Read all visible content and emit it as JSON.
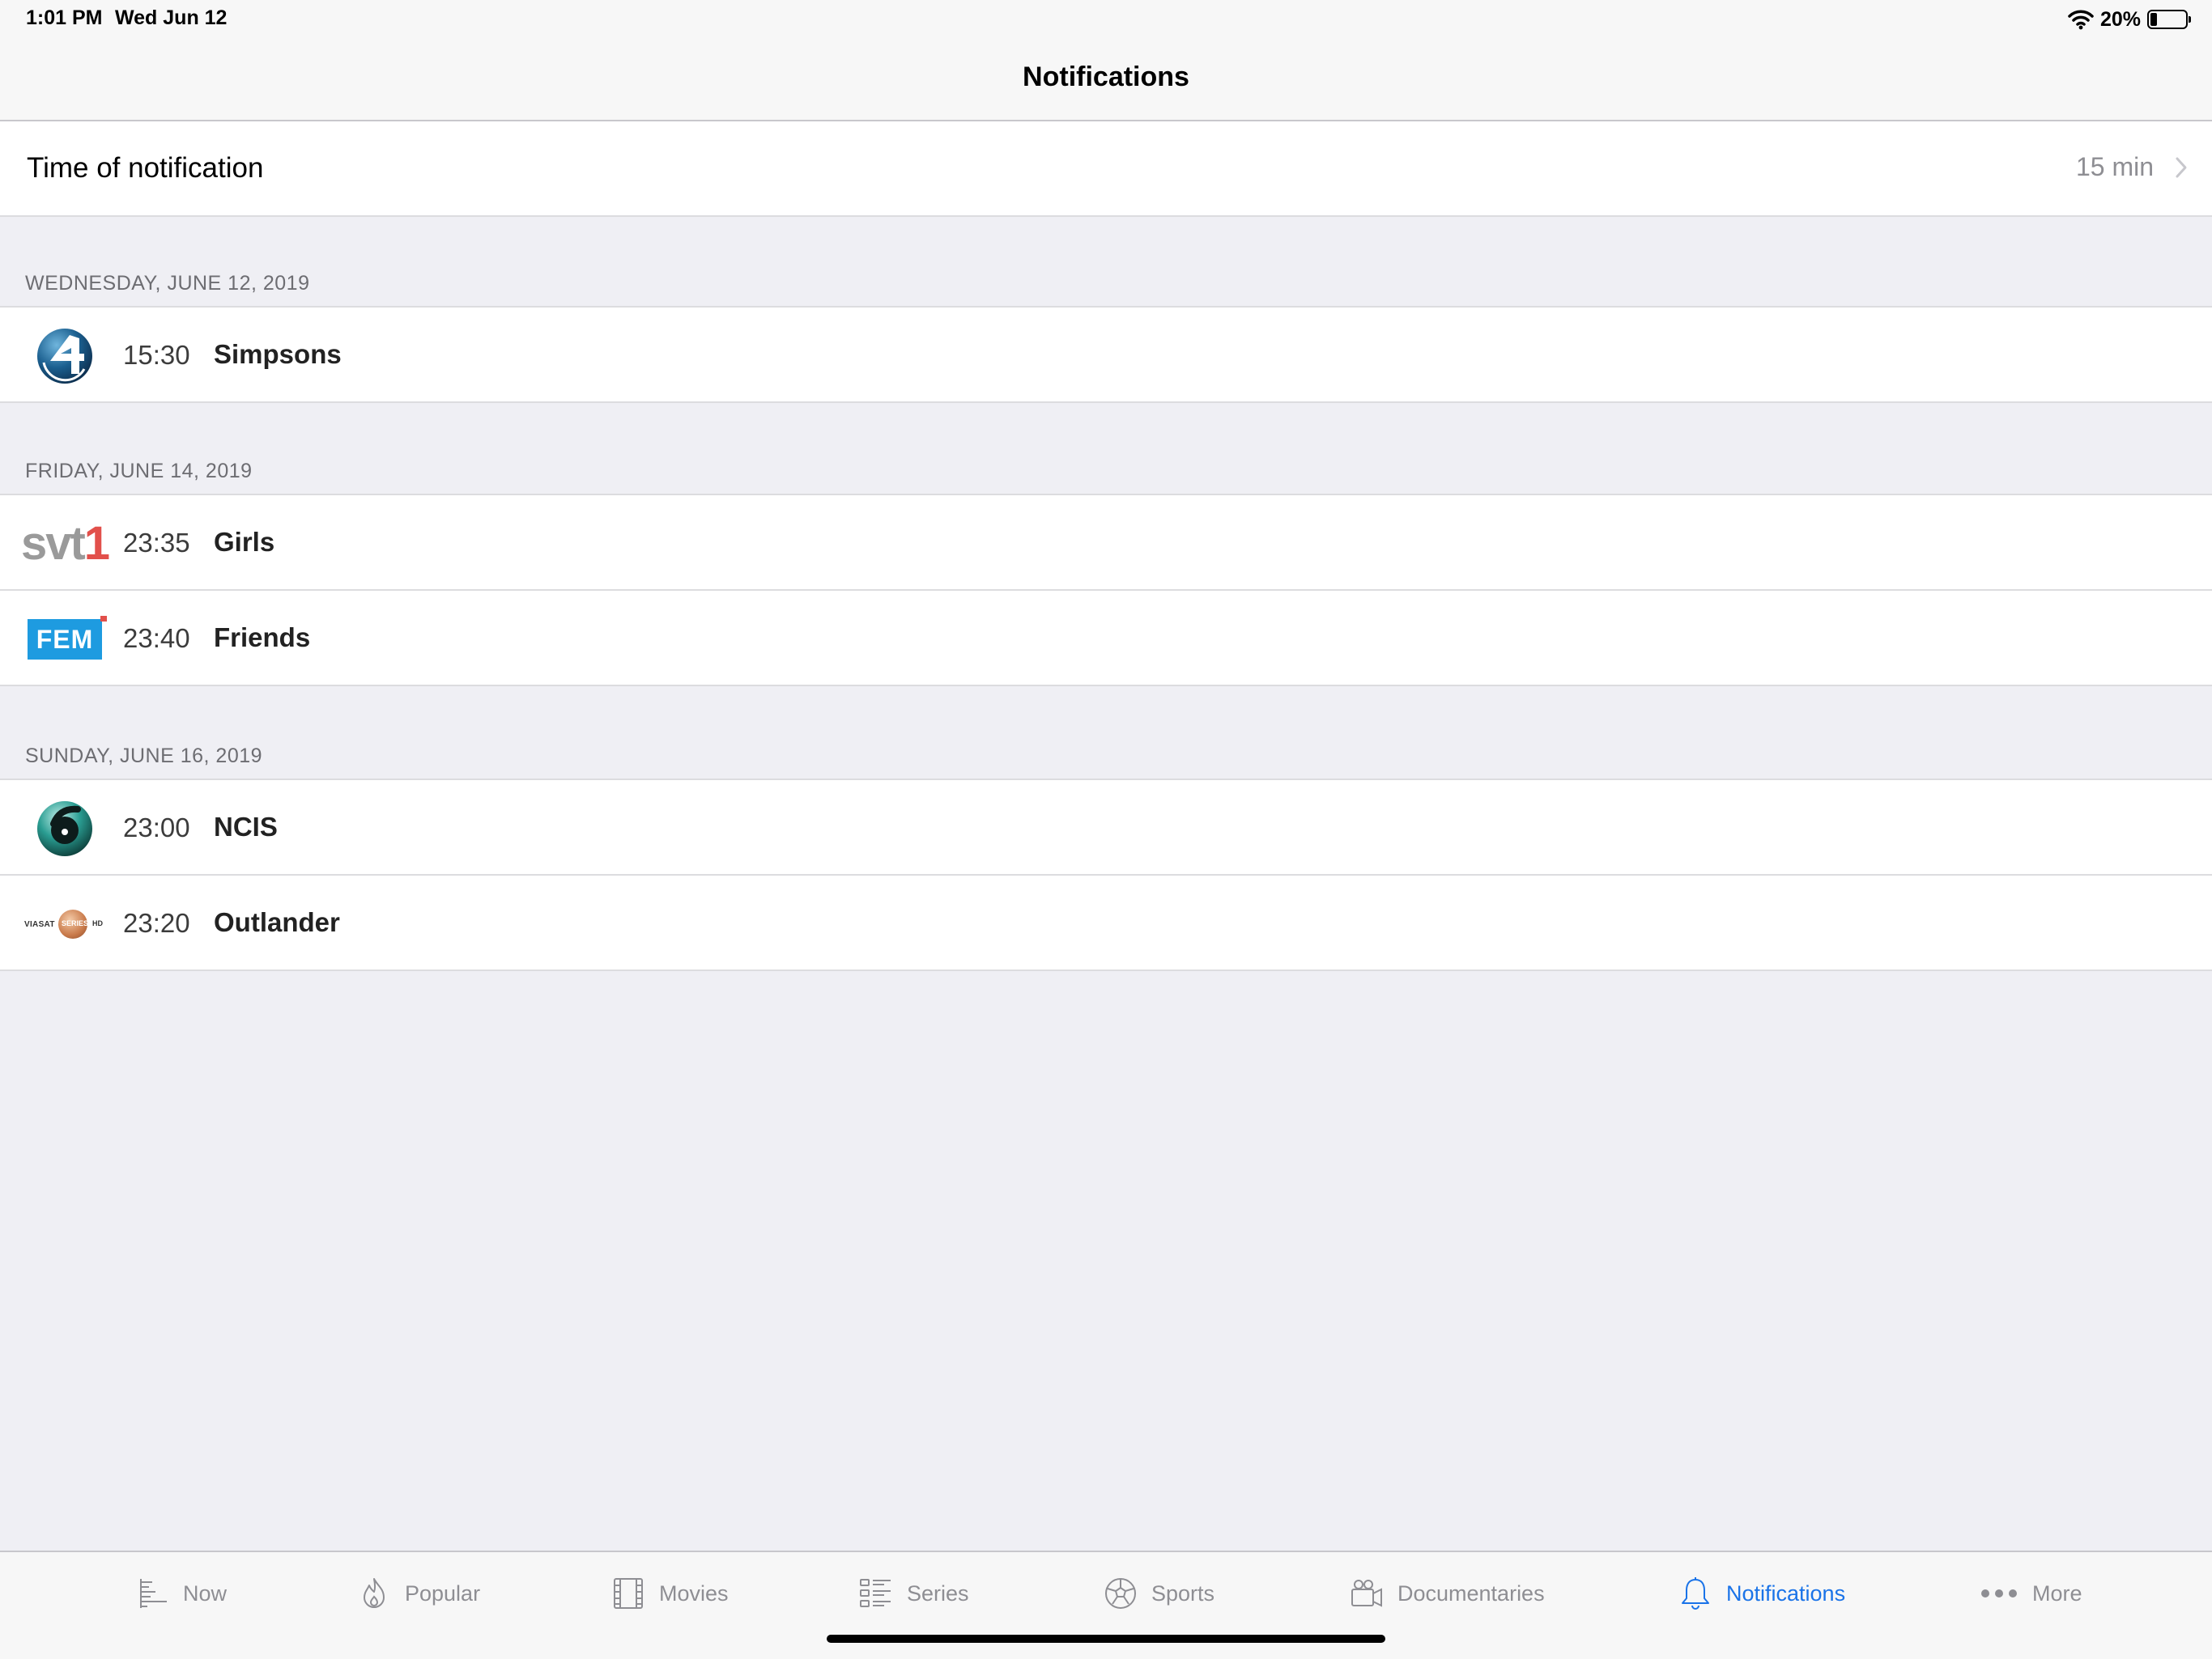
{
  "status_bar": {
    "time": "1:01 PM",
    "date": "Wed Jun 12",
    "battery_text": "20%",
    "battery_level": 0.2
  },
  "nav": {
    "title": "Notifications"
  },
  "settings": {
    "time_of_notification_label": "Time of notification",
    "time_of_notification_value": "15 min"
  },
  "sections": [
    {
      "header": "WEDNESDAY, JUNE 12, 2019",
      "items": [
        {
          "channel": "channel-4-logo",
          "time": "15:30",
          "title": "Simpsons"
        }
      ]
    },
    {
      "header": "FRIDAY, JUNE 14, 2019",
      "items": [
        {
          "channel": "svt1-logo",
          "time": "23:35",
          "title": "Girls"
        },
        {
          "channel": "fem-logo",
          "time": "23:40",
          "title": "Friends"
        }
      ]
    },
    {
      "header": "SUNDAY, JUNE 16, 2019",
      "items": [
        {
          "channel": "channel-6-logo",
          "time": "23:00",
          "title": "NCIS"
        },
        {
          "channel": "viasat-series-hd-logo",
          "time": "23:20",
          "title": "Outlander"
        }
      ]
    }
  ],
  "logos": {
    "svt": "svt",
    "svt_num": "1",
    "fem": "FEM",
    "viasat": "VIASAT",
    "viasat_series": "SERIES",
    "viasat_hd": "HD"
  },
  "tabs": [
    {
      "label": "Now",
      "icon": "timeline-icon"
    },
    {
      "label": "Popular",
      "icon": "flame-icon"
    },
    {
      "label": "Movies",
      "icon": "film-icon"
    },
    {
      "label": "Series",
      "icon": "list-icon"
    },
    {
      "label": "Sports",
      "icon": "soccer-ball-icon"
    },
    {
      "label": "Documentaries",
      "icon": "video-camera-icon"
    },
    {
      "label": "Notifications",
      "icon": "bell-icon",
      "active": true
    },
    {
      "label": "More",
      "icon": "ellipsis-icon"
    }
  ],
  "colors": {
    "accent": "#1a73e8",
    "background": "#efeff4",
    "secondary_text": "#8e8e93"
  }
}
